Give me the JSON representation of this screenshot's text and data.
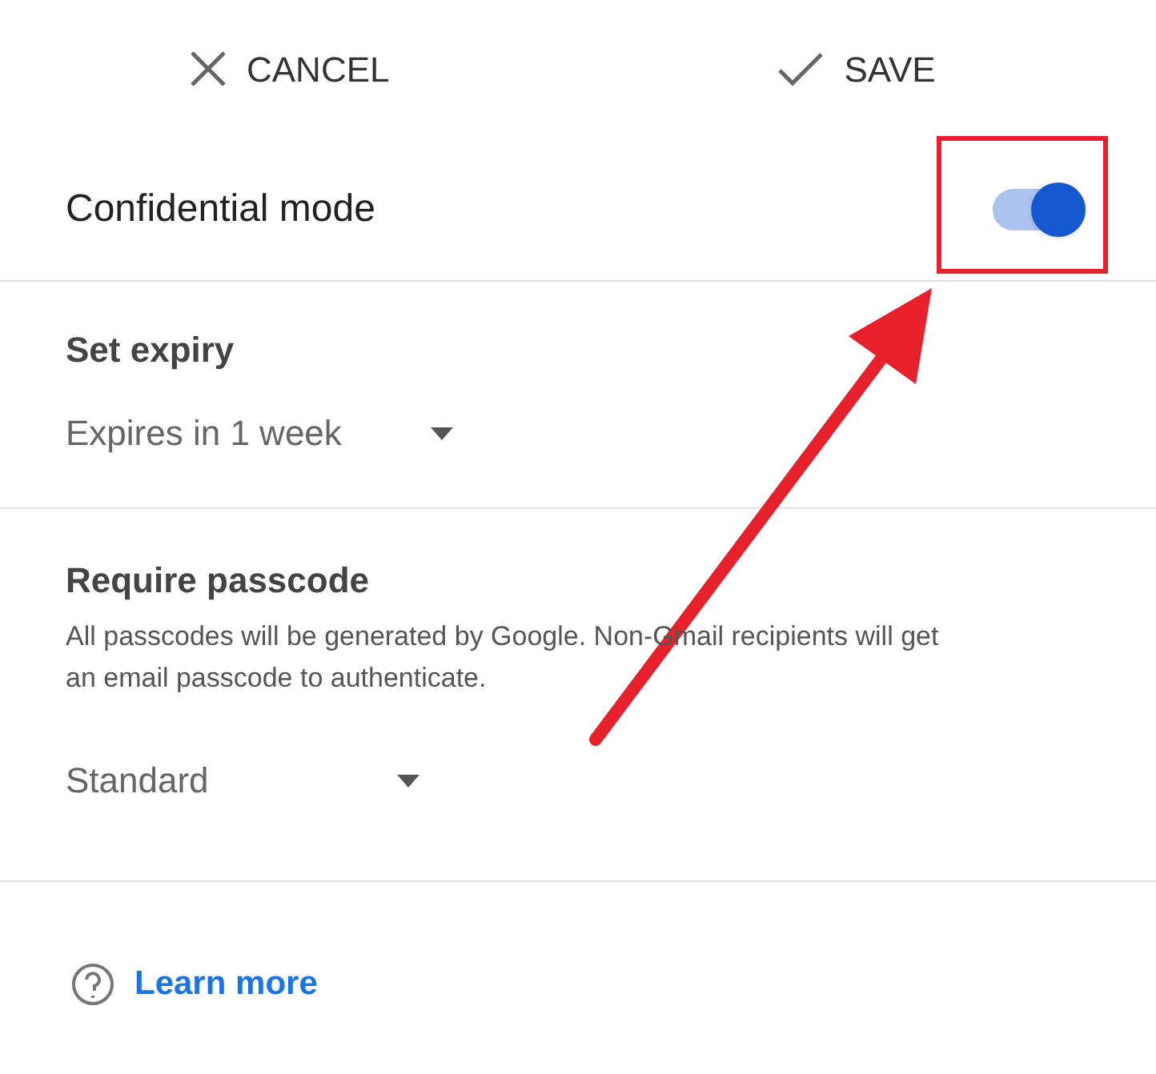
{
  "header": {
    "cancel": "CANCEL",
    "save": "SAVE"
  },
  "confidential": {
    "label": "Confidential mode",
    "on": true
  },
  "expiry": {
    "title": "Set expiry",
    "value": "Expires in 1 week"
  },
  "passcode": {
    "title": "Require passcode",
    "description": "All passcodes will be generated by Google. Non-Gmail recipients will get an email passcode to authenticate.",
    "value": "Standard"
  },
  "help": {
    "link": "Learn more"
  }
}
